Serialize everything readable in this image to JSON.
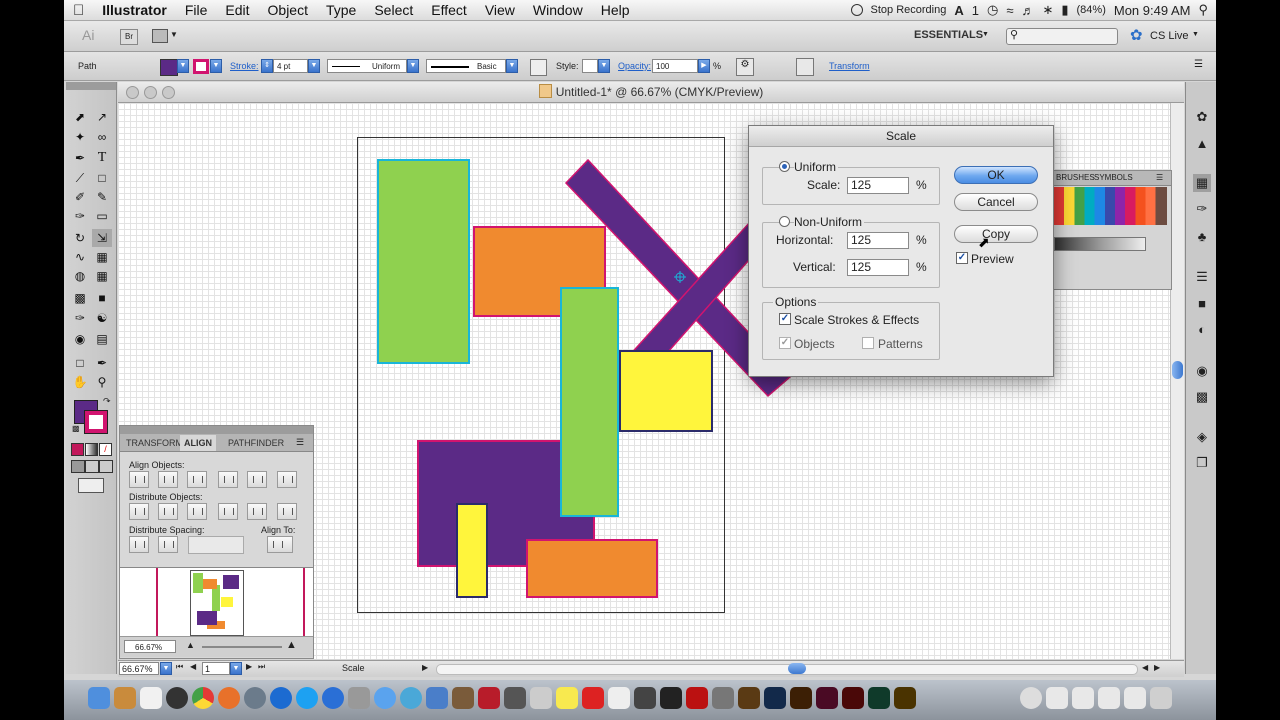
{
  "menubar": {
    "app_name": "Illustrator",
    "items": [
      "File",
      "Edit",
      "Object",
      "Type",
      "Select",
      "Effect",
      "View",
      "Window",
      "Help"
    ],
    "stop_recording": "Stop Recording",
    "ai_label": "1",
    "battery": "(84%)",
    "clock": "Mon 9:49 AM"
  },
  "appbar": {
    "ai_logo": "Ai",
    "br_label": "Br",
    "workspace": "ESSENTIALS",
    "cs_live": "CS Live"
  },
  "controlbar": {
    "selection_type": "Path",
    "stroke_label": "Stroke:",
    "stroke_weight": "4 pt",
    "profile": "Uniform",
    "brush": "Basic",
    "style_label": "Style:",
    "opacity_label": "Opacity:",
    "opacity_value": "100",
    "opacity_unit": "%",
    "transform_link": "Transform",
    "fill_color": "#5b2a86",
    "stroke_color": "#d1146f"
  },
  "document": {
    "title": "Untitled-1* @ 66.67% (CMYK/Preview)"
  },
  "align_panel": {
    "tabs": [
      "TRANSFORM",
      "ALIGN",
      "PATHFINDER"
    ],
    "align_objects_label": "Align Objects:",
    "distribute_objects_label": "Distribute Objects:",
    "distribute_spacing_label": "Distribute Spacing:",
    "align_to_label": "Align To:",
    "navigator_zoom": "66.67%"
  },
  "statusbar": {
    "zoom": "66.67%",
    "artboard_number": "1",
    "tool_name": "Scale"
  },
  "swatches_panel": {
    "tabs": [
      "BRUSHES",
      "SYMBOLS"
    ]
  },
  "scale_dialog": {
    "title": "Scale",
    "uniform_label": "Uniform",
    "scale_label": "Scale:",
    "scale_value": "125",
    "non_uniform_label": "Non-Uniform",
    "horizontal_label": "Horizontal:",
    "horizontal_value": "125",
    "vertical_label": "Vertical:",
    "vertical_value": "125",
    "percent": "%",
    "options_label": "Options",
    "scale_strokes_label": "Scale Strokes & Effects",
    "objects_label": "Objects",
    "patterns_label": "Patterns",
    "ok_label": "OK",
    "cancel_label": "Cancel",
    "copy_label": "Copy",
    "preview_label": "Preview",
    "uniform_selected": true,
    "scale_strokes_checked": true,
    "objects_checked": true,
    "patterns_checked": false,
    "preview_checked": true
  },
  "colors": {
    "green": "#8fd14f",
    "orange": "#f08a2f",
    "purple": "#5b2a86",
    "yellow": "#fff53c",
    "cyan_stroke": "#19b5d8",
    "magenta_stroke": "#d1146f"
  }
}
